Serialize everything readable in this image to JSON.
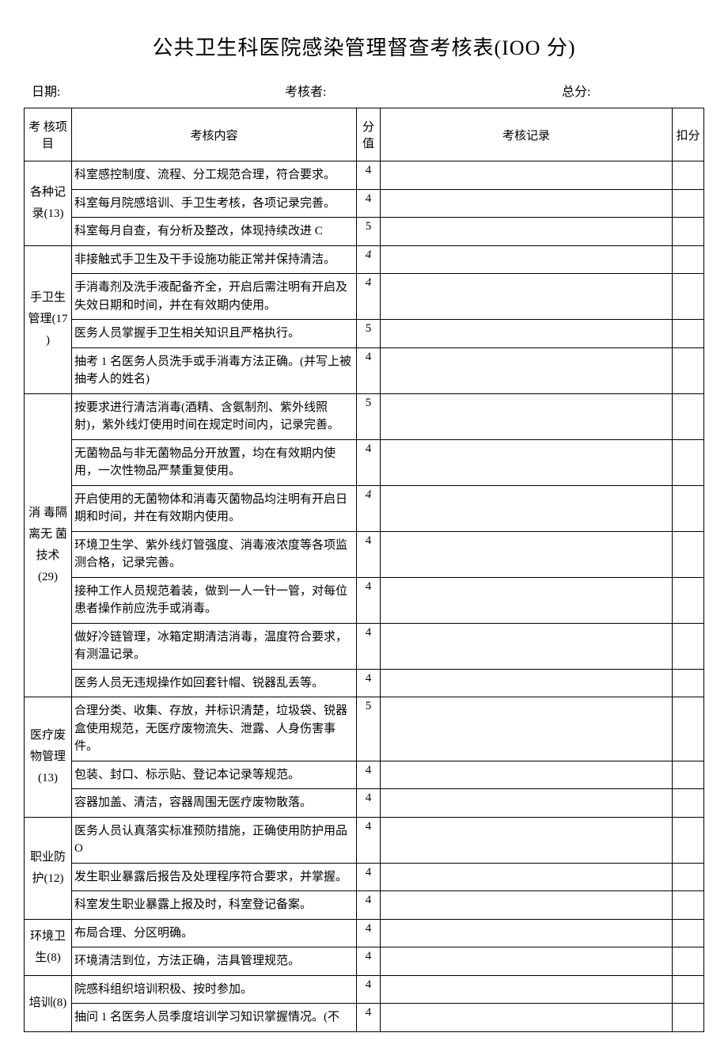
{
  "title": "公共卫生科医院感染管理督查考核表(IOO 分)",
  "meta": {
    "date_label": "日期:",
    "assessor_label": "考核者:",
    "total_label": "总分:"
  },
  "headers": {
    "category": "考 核项目",
    "content": "考核内容",
    "score": "分值",
    "record": "考核记录",
    "deduct": "扣分"
  },
  "sections": [
    {
      "name": "各种记录(13)",
      "rows": [
        {
          "content": "科室感控制度、流程、分工规范合理，符合要求。",
          "score": "4"
        },
        {
          "content": "科室每月院感培训、手卫生考核，各项记录完善。",
          "score": "4"
        },
        {
          "content": "科室每月自查，有分析及整改，体现持续改进 C",
          "score": "5"
        }
      ]
    },
    {
      "name": "手卫生管理(17 )",
      "rows": [
        {
          "content": "非接触式手卫生及干手设施功能正常并保持清洁。",
          "score": "4",
          "italic": true
        },
        {
          "content": "手消毒剂及洗手液配备齐全，开启后需注明有开启及失效日期和时间，并在有效期内使用。",
          "score": "4",
          "italic": true
        },
        {
          "content": "医务人员掌握手卫生相关知识且严格执行。",
          "score": "5"
        },
        {
          "content": "抽考 1 名医务人员洗手或手消毒方法正确。(并写上被抽考人的姓名)",
          "score": "4"
        }
      ]
    },
    {
      "name": "消   毒隔   离无   菌技术(29)",
      "rows": [
        {
          "content": "按要求进行清洁消毒(酒精、含氨制剂、紫外线照射)，紫外线灯使用时间在规定时间内，记录完善。",
          "score": "5"
        },
        {
          "content": "无菌物品与非无菌物品分开放置，均在有效期内使用，一次性物品严禁重复使用。",
          "score": "4"
        },
        {
          "content": "开启使用的无菌物体和消毒灭菌物品均注明有开启日期和时间，并在有效期内使用。",
          "score": "4",
          "italic": true
        },
        {
          "content": "环境卫生学、紫外线灯管强度、消毒液浓度等各项监测合格，记录完善。",
          "score": "4"
        },
        {
          "content": "接种工作人员规范着装，做到一人一针一管，对每位患者操作前应洗手或消毒。",
          "score": "4"
        },
        {
          "content": "做好冷链管理，冰箱定期清洁消毒，温度符合要求，有测温记录。",
          "score": "4"
        },
        {
          "content": "医务人员无违规操作如回套针帽、锐器乱丢等。",
          "score": "4"
        }
      ]
    },
    {
      "name": "医疗废物管理(13)",
      "rows": [
        {
          "content": "合理分类、收集、存放，并标识清楚，垃圾袋、锐器盒使用规范，无医疗废物流失、泄露、人身伤害事件。",
          "score": "5"
        },
        {
          "content": "包装、封口、标示贴、登记本记录等规范。",
          "score": "4"
        },
        {
          "content": "容器加盖、清洁，容器周围无医疗废物散落。",
          "score": "4"
        }
      ]
    },
    {
      "name": "职业防护(12)",
      "rows": [
        {
          "content": "医务人员认真落实标准预防措施，正确使用防护用品 O",
          "score": "4"
        },
        {
          "content": "发生职业暴露后报告及处理程序符合要求，并掌握。",
          "score": "4"
        },
        {
          "content": "科室发生职业暴露上报及时，科室登记备案。",
          "score": "4"
        }
      ]
    },
    {
      "name": "环境卫生(8)",
      "rows": [
        {
          "content": "布局合理、分区明确。",
          "score": "4"
        },
        {
          "content": "环境清洁到位，方法正确，洁具管理规范。",
          "score": "4"
        }
      ]
    },
    {
      "name": "培训(8)",
      "rows": [
        {
          "content": "院感科组织培训积极、按时参加。",
          "score": "4"
        },
        {
          "content": "抽问 1 名医务人员季度培训学习知识掌握情况。(不",
          "score": "4"
        }
      ]
    }
  ]
}
